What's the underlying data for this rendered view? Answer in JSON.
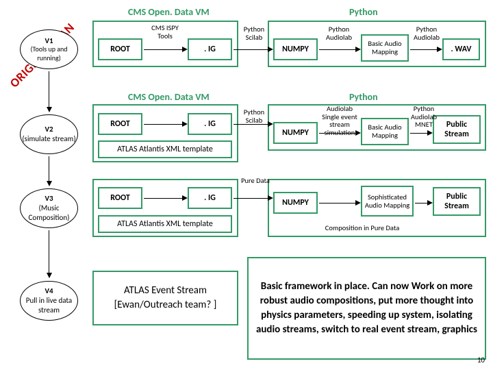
{
  "stamp": "ORIGINAL PLAN",
  "ovals": {
    "v1": {
      "title": "V1",
      "sub": "(Tools up and running)"
    },
    "v2": {
      "title": "V2",
      "sub": "(simulate stream)"
    },
    "v3": {
      "title": "V3",
      "sub": "(Music Composition)"
    },
    "v4": {
      "title": "V4",
      "sub": "Pull in live data stream"
    }
  },
  "row1": {
    "header_left": "CMS Open. Data VM",
    "header_right": "Python",
    "root": "ROOT",
    "ig": ". IG",
    "numpy": "NUMPY",
    "basic_audio": "Basic Audio Mapping",
    "wav": ". WAV",
    "l_cms_ispy": "CMS ISPY Tools",
    "l_py_scilab": "Python Scilab",
    "l_py_audio_l": "Python Audiolab",
    "l_py_audio_r": "Python Audiolab"
  },
  "row2": {
    "header_left": "CMS Open. Data VM",
    "header_right": "Python",
    "root": "ROOT",
    "ig": ". IG",
    "numpy": "NUMPY",
    "basic_audio": "Basic Audio Mapping",
    "public_stream": "Public Stream",
    "l_py_scilab": "Python Scilab",
    "l_audiolab_single": "Audiolab Single event stream simulation",
    "l_py_audio_mnet": "Python Audiolab MNET",
    "atlas": "ATLAS Atlantis XML template"
  },
  "row3": {
    "root": "ROOT",
    "ig": ". IG",
    "numpy": "NUMPY",
    "soph": "Sophisticated Audio Mapping",
    "public_stream": "Public Stream",
    "l_pure": "Pure Data",
    "l_comp": "Composition in Pure Data",
    "atlas": "ATLAS Atlantis XML template"
  },
  "row4": {
    "event_stream": "ATLAS Event Stream [Ewan/Outreach team? ]",
    "summary": "Basic framework in place. Can now Work on more robust audio compositions, put more thought into physics parameters, speeding up system, isolating audio streams, switch to real event stream, graphics"
  },
  "pagenum": "10"
}
